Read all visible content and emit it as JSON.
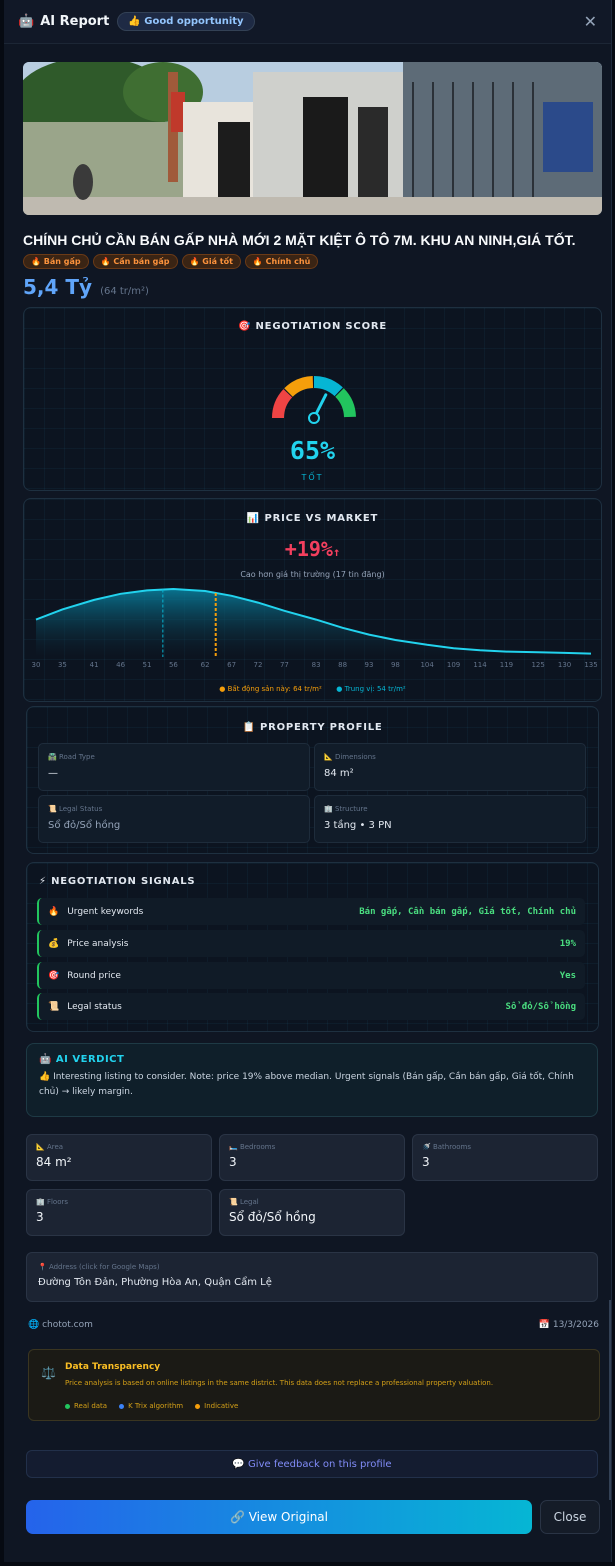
{
  "header": {
    "icon": "robot-icon",
    "title": "AI Report",
    "badge": "👍 Good opportunity",
    "close": "✕"
  },
  "listing": {
    "title": "CHÍNH CHỦ CẦN BÁN GẤP NHÀ MỚI 2 MẶT KIỆT Ô TÔ 7M. KHU AN NINH,GIÁ TỐT.",
    "tags": [
      "🔥 Bán gấp",
      "🔥 Cần bán gấp",
      "🔥 Giá tốt",
      "🔥 Chính chủ"
    ],
    "price": "5,4 Tỷ",
    "price_per_m2": "(64 tr/m²)"
  },
  "negotiation_score": {
    "heading": "🎯 NEGOTIATION SCORE",
    "value": 65,
    "value_text": "65%",
    "label": "TỐT",
    "colors": [
      "#ef4444",
      "#f59e0b",
      "#06b6d4",
      "#22c55e"
    ]
  },
  "price_vs_market": {
    "heading": "📊 PRICE VS MARKET",
    "diff": "+19%",
    "arrow": "↑",
    "sub": "Cao hơn giá thị trường (17 tin đăng)",
    "legend_this": "● Bất động sản này: 64 tr/m²",
    "legend_median": "● Trung vị: 54 tr/m²"
  },
  "chart_data": {
    "type": "area",
    "x": [
      30,
      35,
      41,
      46,
      51,
      56,
      62,
      67,
      72,
      77,
      83,
      88,
      93,
      98,
      104,
      109,
      114,
      119,
      125,
      130,
      135
    ],
    "y": [
      0.55,
      0.7,
      0.84,
      0.93,
      0.98,
      1.0,
      0.97,
      0.9,
      0.8,
      0.68,
      0.55,
      0.43,
      0.33,
      0.25,
      0.18,
      0.13,
      0.1,
      0.08,
      0.07,
      0.06,
      0.05
    ],
    "tick_labels": [
      "30",
      "35",
      "41",
      "46",
      "51",
      "56",
      "62",
      "67",
      "72",
      "77",
      "83",
      "88",
      "93",
      "98",
      "104",
      "109",
      "114",
      "119",
      "125",
      "130",
      "135"
    ],
    "markers": {
      "property": 64,
      "median": 54
    },
    "colors": {
      "line": "#22d3ee",
      "property": "#f59e0b",
      "median": "#06b6d4"
    }
  },
  "profile": {
    "heading": "📋 PROPERTY PROFILE",
    "cells": [
      {
        "label": "🛣️ Road Type",
        "value": "—"
      },
      {
        "label": "📐 Dimensions",
        "value": "84 m²"
      },
      {
        "label": "📜 Legal Status",
        "value": "Sổ đỏ/Sổ hồng"
      },
      {
        "label": "🏢 Structure",
        "value": "3 tầng • 3 PN"
      }
    ]
  },
  "signals": {
    "heading": "⚡ NEGOTIATION SIGNALS",
    "items": [
      {
        "icon": "🔥",
        "name": "Urgent keywords",
        "value": "Bán gấp, Cần bán gấp, Giá tốt, Chính chủ"
      },
      {
        "icon": "💰",
        "name": "Price analysis",
        "value": "19%"
      },
      {
        "icon": "🎯",
        "name": "Round price",
        "value": "Yes"
      },
      {
        "icon": "📜",
        "name": "Legal status",
        "value": "Sổ đỏ/Sổ hồng"
      }
    ]
  },
  "verdict": {
    "heading": "🤖 AI VERDICT",
    "text": "👍 Interesting listing to consider. Note: price 19% above median. Urgent signals (Bán gấp, Cần bán gấp, Giá tốt, Chính chủ) → likely margin."
  },
  "stats": [
    {
      "label": "📐 Area",
      "value": "84 m²"
    },
    {
      "label": "🛏️ Bedrooms",
      "value": "3"
    },
    {
      "label": "🚿 Bathrooms",
      "value": "3"
    },
    {
      "label": "🏢 Floors",
      "value": "3"
    },
    {
      "label": "📜 Legal",
      "value": "Sổ đỏ/Sổ hồng"
    }
  ],
  "address": {
    "label": "📍 Address (click for Google Maps)",
    "value": "Đường Tôn Đản, Phường Hòa An, Quận Cẩm Lệ"
  },
  "source": {
    "site": "🌐 chotot.com",
    "date": "📅 13/3/2026"
  },
  "transparency": {
    "icon": "⚖️",
    "title": "Data Transparency",
    "text": "Price analysis is based on online listings in the same district. This data does not replace a professional property valuation.",
    "legend": [
      "Real data",
      "K Trix algorithm",
      "Indicative"
    ],
    "legend_colors": [
      "#22c55e",
      "#3b82f6",
      "#f59e0b"
    ]
  },
  "actions": {
    "feedback": "💬 Give feedback on this profile",
    "view": "🔗 View Original",
    "close": "Close"
  }
}
